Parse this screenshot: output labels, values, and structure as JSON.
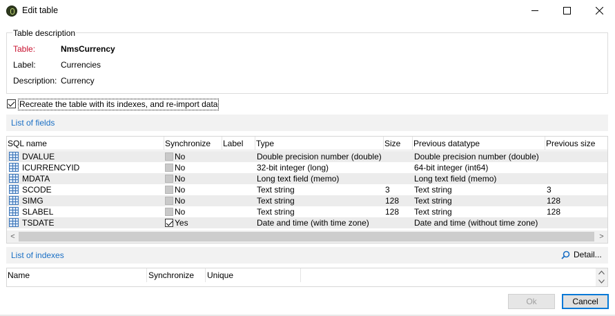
{
  "window": {
    "title": "Edit table",
    "controls": {
      "minimize": "—",
      "maximize": "☐",
      "close": "✕"
    }
  },
  "table_description": {
    "legend": "Table description",
    "table_label": "Table:",
    "table_value": "NmsCurrency",
    "label_label": "Label:",
    "label_value": "Currencies",
    "description_label": "Description:",
    "description_value": "Currency"
  },
  "recreate_option": {
    "label": "Recreate the table with its indexes, and re-import data",
    "checked": true
  },
  "fields_section": {
    "title": "List of fields",
    "columns": [
      "SQL name",
      "Synchronize",
      "Label",
      "Type",
      "Size",
      "Previous datatype",
      "Previous size"
    ],
    "rows": [
      {
        "sql_name": "DVALUE",
        "synchronize": "No",
        "sync_checked": false,
        "label": "",
        "type": "Double precision number (double)",
        "size": "",
        "previous_datatype": "Double precision number (double)",
        "previous_size": ""
      },
      {
        "sql_name": "ICURRENCYID",
        "synchronize": "No",
        "sync_checked": false,
        "label": "",
        "type": "32-bit integer (long)",
        "size": "",
        "previous_datatype": "64-bit integer (int64)",
        "previous_size": ""
      },
      {
        "sql_name": "MDATA",
        "synchronize": "No",
        "sync_checked": false,
        "label": "",
        "type": "Long text field (memo)",
        "size": "",
        "previous_datatype": "Long text field (memo)",
        "previous_size": ""
      },
      {
        "sql_name": "SCODE",
        "synchronize": "No",
        "sync_checked": false,
        "label": "",
        "type": "Text string",
        "size": "3",
        "previous_datatype": "Text string",
        "previous_size": "3"
      },
      {
        "sql_name": "SIMG",
        "synchronize": "No",
        "sync_checked": false,
        "label": "",
        "type": "Text string",
        "size": "128",
        "previous_datatype": "Text string",
        "previous_size": "128"
      },
      {
        "sql_name": "SLABEL",
        "synchronize": "No",
        "sync_checked": false,
        "label": "",
        "type": "Text string",
        "size": "128",
        "previous_datatype": "Text string",
        "previous_size": "128"
      },
      {
        "sql_name": "TSDATE",
        "synchronize": "Yes",
        "sync_checked": true,
        "label": "",
        "type": "Date and time (with time zone)",
        "size": "",
        "previous_datatype": "Date and time (without time zone)",
        "previous_size": ""
      }
    ],
    "scroll_left": "<",
    "scroll_right": ">"
  },
  "indexes_section": {
    "title": "List of indexes",
    "detail_label": "Detail...",
    "columns": [
      "Name",
      "Synchronize",
      "Unique"
    ],
    "scroll_up": "^",
    "scroll_down": "v"
  },
  "buttons": {
    "ok": "Ok",
    "cancel": "Cancel"
  },
  "colors": {
    "link": "#1a6fc4",
    "required_label": "#c8102e",
    "table_icon": "#3a74b8"
  },
  "icons": {
    "app": "app-logo-icon",
    "table": "table-icon",
    "search": "search-icon"
  }
}
